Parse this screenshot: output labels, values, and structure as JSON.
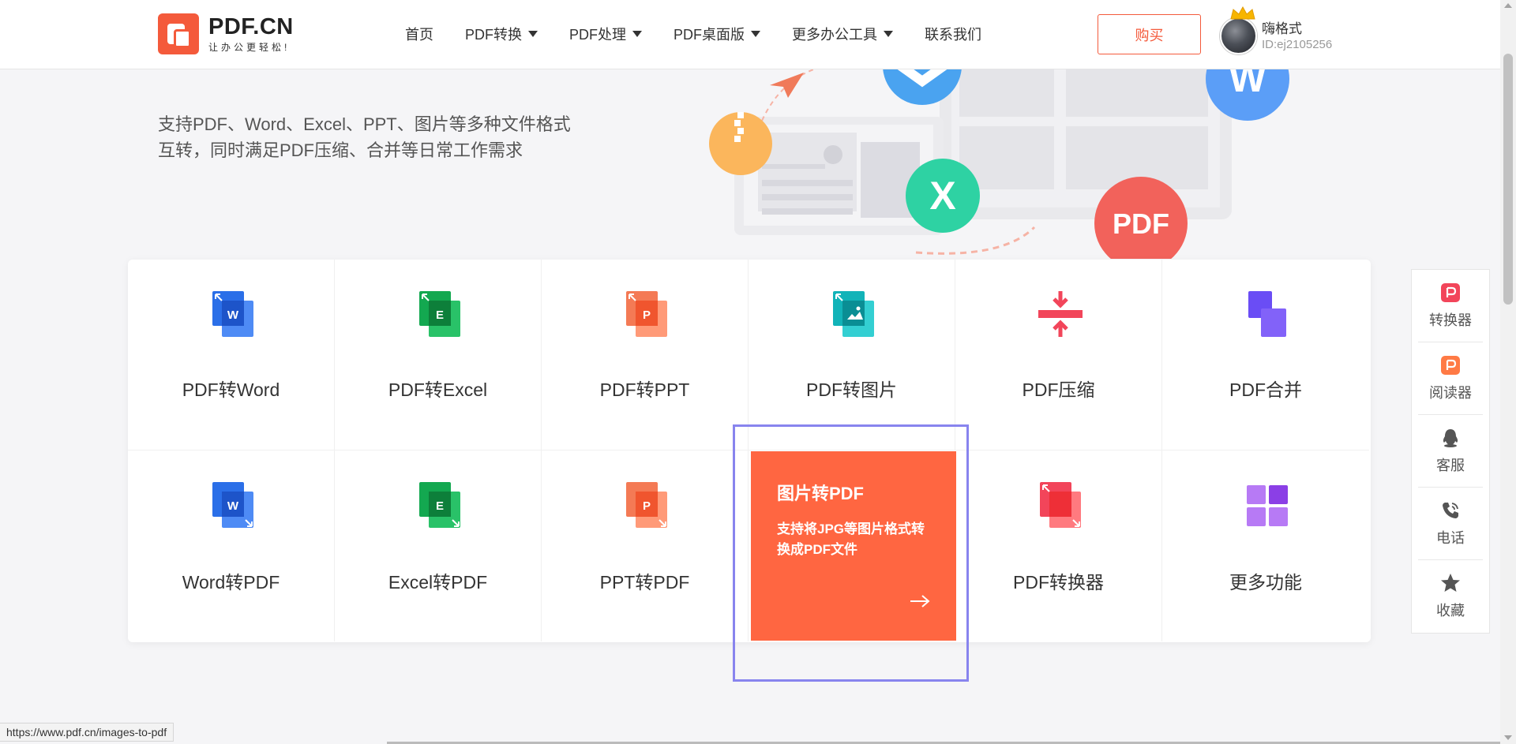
{
  "header": {
    "logo_title": "PDF.CN",
    "logo_sub": "让办公更轻松!",
    "nav": [
      {
        "label": "首页",
        "dropdown": false
      },
      {
        "label": "PDF转换",
        "dropdown": true
      },
      {
        "label": "PDF处理",
        "dropdown": true
      },
      {
        "label": "PDF桌面版",
        "dropdown": true
      },
      {
        "label": "更多办公工具",
        "dropdown": true
      },
      {
        "label": "联系我们",
        "dropdown": false
      }
    ],
    "buy_label": "购买",
    "user": {
      "name": "嗨格式",
      "id": "ID:ej2105256"
    }
  },
  "hero": {
    "line1": "支持PDF、Word、Excel、PPT、图片等多种文件格式",
    "line2": "互转，同时满足PDF压缩、合并等日常工作需求",
    "bubble_x": "X",
    "bubble_w": "W",
    "bubble_pdf": "PDF"
  },
  "tools": {
    "row1": [
      {
        "label": "PDF转Word",
        "icon": "word-icon",
        "letter": "W"
      },
      {
        "label": "PDF转Excel",
        "icon": "excel-icon",
        "letter": "E"
      },
      {
        "label": "PDF转PPT",
        "icon": "ppt-icon",
        "letter": "P"
      },
      {
        "label": "PDF转图片",
        "icon": "image-icon"
      },
      {
        "label": "PDF压缩",
        "icon": "compress-icon"
      },
      {
        "label": "PDF合并",
        "icon": "merge-icon"
      }
    ],
    "row2": [
      {
        "label": "Word转PDF",
        "icon": "word-icon",
        "letter": "W"
      },
      {
        "label": "Excel转PDF",
        "icon": "excel-icon",
        "letter": "E"
      },
      {
        "label": "PPT转PDF",
        "icon": "ppt-icon",
        "letter": "P"
      },
      {
        "label": "图片转PDF",
        "icon": "image-icon"
      },
      {
        "label": "PDF转换器",
        "icon": "converter-icon"
      },
      {
        "label": "更多功能",
        "icon": "grid-icon"
      }
    ],
    "feature": {
      "title": "图片转PDF",
      "desc": "支持将JPG等图片格式转换成PDF文件"
    }
  },
  "sidebar": [
    {
      "label": "转换器",
      "icon": "converter-app-icon"
    },
    {
      "label": "阅读器",
      "icon": "reader-app-icon"
    },
    {
      "label": "客服",
      "icon": "qq-icon"
    },
    {
      "label": "电话",
      "icon": "phone-icon"
    },
    {
      "label": "收藏",
      "icon": "star-icon"
    }
  ],
  "status_url": "https://www.pdf.cn/images-to-pdf",
  "colors": {
    "brand": "#f45a3b",
    "feature_bg": "#ff6641",
    "highlight": "#8884ee"
  }
}
